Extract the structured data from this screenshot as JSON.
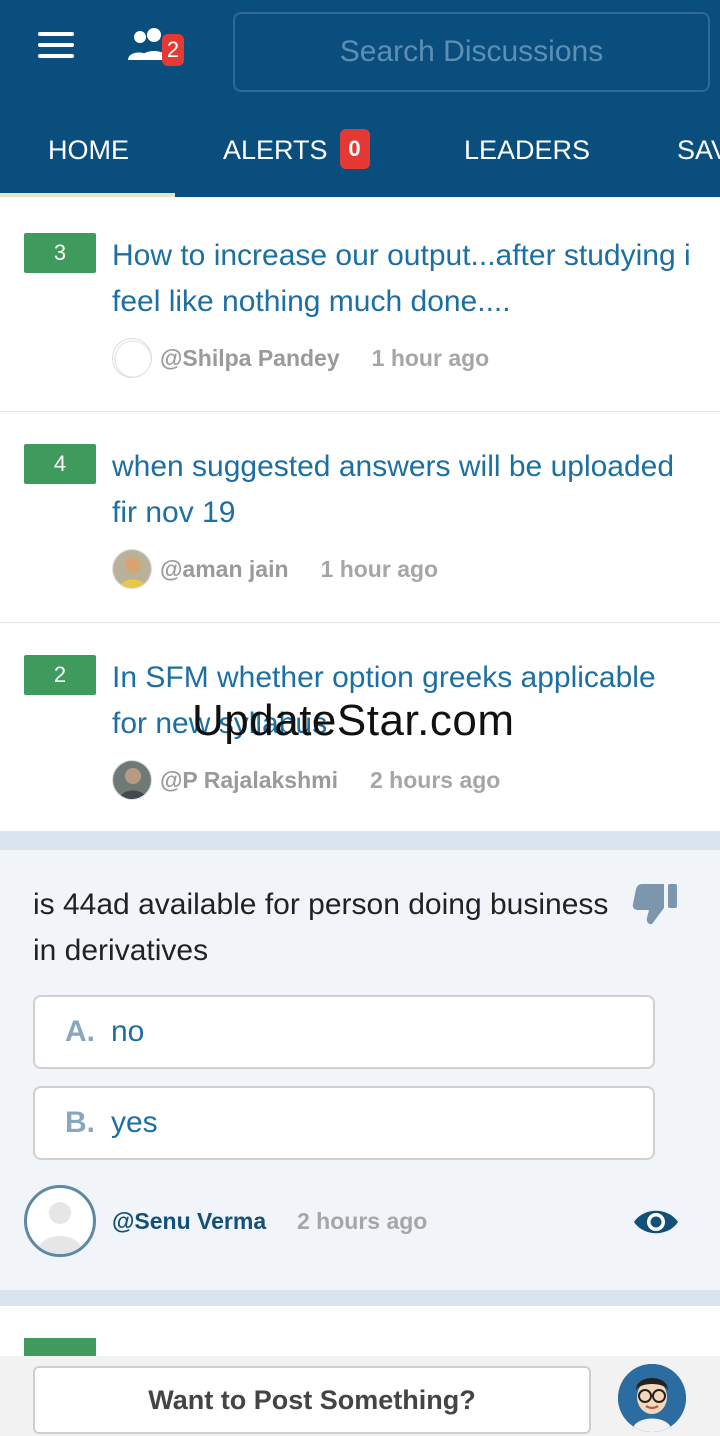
{
  "header": {
    "menu_icon": "hamburger-menu-icon",
    "people_icon": "people-icon",
    "people_badge": "2",
    "search_placeholder": "Search Discussions"
  },
  "tabs": [
    {
      "label": "HOME",
      "active": true
    },
    {
      "label": "ALERTS",
      "badge": "0"
    },
    {
      "label": "LEADERS"
    },
    {
      "label": "SAV"
    }
  ],
  "feed": [
    {
      "votes": "3",
      "title": "How to increase our output...after studying i feel like nothing much done....",
      "user": "@Shilpa Pandey",
      "time": "1 hour ago"
    },
    {
      "votes": "4",
      "title": "when suggested answers will be uploaded fir nov 19",
      "user": "@aman jain",
      "time": "1 hour ago"
    },
    {
      "votes": "2",
      "title": "In SFM whether option greeks applicable for new syllabus",
      "user": "@P Rajalakshmi",
      "time": "2 hours ago"
    }
  ],
  "watermark": "UpdateStar.com",
  "poll": {
    "question": "is 44ad available for person doing business in derivatives",
    "options": [
      {
        "letter": "A.",
        "text": "no"
      },
      {
        "letter": "B.",
        "text": "yes"
      }
    ],
    "user": "@Senu Verma",
    "time": "2 hours ago"
  },
  "bottom": {
    "post_label": "Want to Post Something?"
  },
  "colors": {
    "header_bg": "#0a4e7e",
    "vote_badge": "#3f9b5d",
    "title_link": "#1c6fa2",
    "badge_red": "#e53935"
  }
}
